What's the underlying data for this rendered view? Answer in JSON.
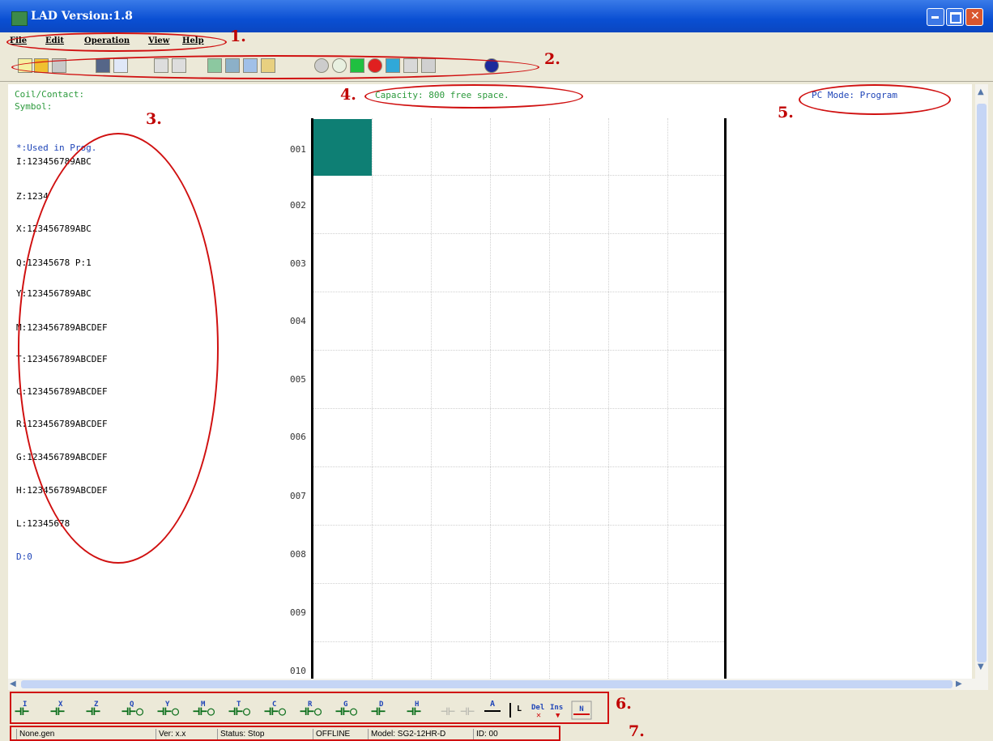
{
  "window": {
    "title": "LAD Version:1.8"
  },
  "menu": [
    "File",
    "Edit",
    "Operation",
    "View",
    "Help"
  ],
  "annotations": [
    "1.",
    "2.",
    "3.",
    "4.",
    "5.",
    "6.",
    "7."
  ],
  "program": {
    "coil_contact_label": "Coil/Contact:",
    "symbol_label": "Symbol:",
    "capacity": "Capacity: 800 free space.",
    "pc_mode": "PC Mode: Program",
    "used_label": "*:Used in Prog.",
    "variables": [
      "I:123456789ABC",
      "Z:1234",
      "X:123456789ABC",
      "Q:12345678 P:1",
      "Y:123456789ABC",
      "M:123456789ABCDEF",
      "T:123456789ABCDEF",
      "C:123456789ABCDEF",
      "R:123456789ABCDEF",
      "G:123456789ABCDEF",
      "H:123456789ABCDEF",
      "L:12345678",
      "D:0"
    ],
    "rows": [
      "001",
      "002",
      "003",
      "004",
      "005",
      "006",
      "007",
      "008",
      "009",
      "010"
    ]
  },
  "bottom_toolbar": {
    "contacts": [
      "I",
      "X",
      "Z",
      "Q",
      "Y",
      "M",
      "T",
      "C",
      "R",
      "G",
      "D",
      "H"
    ],
    "line_a": "A",
    "line_l": "L",
    "del": "Del",
    "ins": "Ins",
    "n": "N"
  },
  "status": {
    "file": "None.gen",
    "version": "Ver: x.x",
    "state": "Status: Stop",
    "connection": "OFFLINE",
    "model": "Model: SG2-12HR-D",
    "id": "ID: 00"
  },
  "colors": {
    "accent_green": "#2c9a3c",
    "accent_blue": "#1f45b8",
    "cursor": "#0e7f74",
    "annotation_red": "#d01010"
  }
}
